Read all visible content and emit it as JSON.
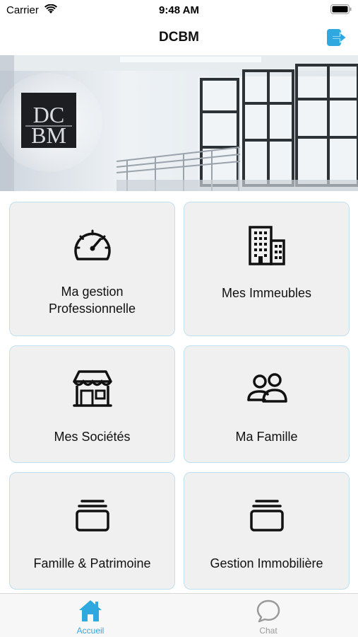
{
  "status_bar": {
    "carrier": "Carrier",
    "time": "9:48 AM"
  },
  "nav": {
    "title": "DCBM",
    "logout_icon": "logout-icon"
  },
  "banner": {
    "logo_text_top": "DC",
    "logo_text_bottom": "BM"
  },
  "tiles": [
    {
      "label": "Ma gestion\nProfessionnelle",
      "icon": "speedometer-icon"
    },
    {
      "label": "Mes Immeubles",
      "icon": "building-icon"
    },
    {
      "label": "Mes Sociétés",
      "icon": "storefront-icon"
    },
    {
      "label": "Ma Famille",
      "icon": "people-icon"
    },
    {
      "label": "Famille & Patrimoine",
      "icon": "albums-icon"
    },
    {
      "label": "Gestion Immobilière",
      "icon": "albums-icon"
    }
  ],
  "tab_bar": {
    "items": [
      {
        "label": "Accueil",
        "icon": "home-icon",
        "active": true
      },
      {
        "label": "Chat",
        "icon": "chat-icon",
        "active": false
      }
    ]
  },
  "colors": {
    "accent": "#2fa8e0",
    "tile_bg": "#f0f0f0",
    "tile_border": "#bfe0ee",
    "inactive": "#9a9a9a"
  }
}
